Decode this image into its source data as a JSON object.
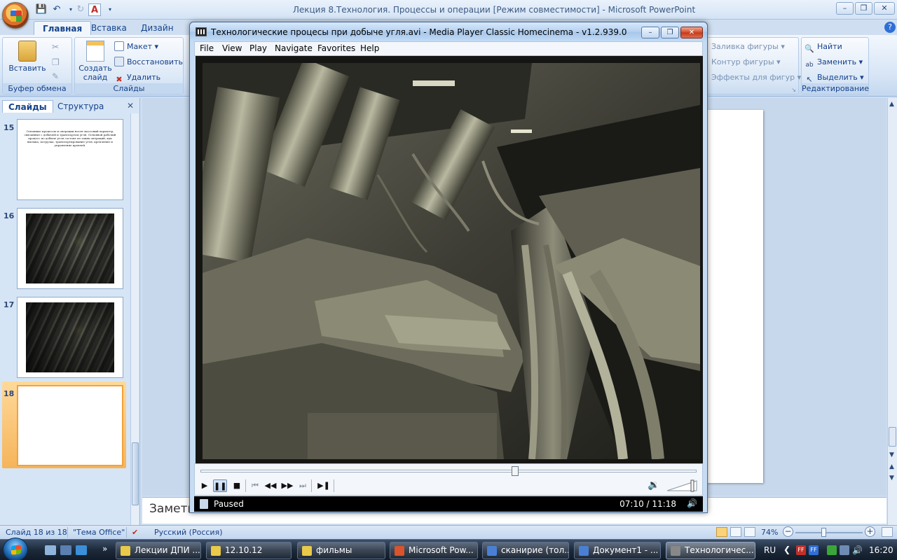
{
  "powerpoint": {
    "window_title": "Лекция 8.Технология. Процессы и операции [Режим совместимости] - Microsoft PowerPoint",
    "tabs": [
      "Главная",
      "Вставка",
      "Дизайн"
    ],
    "clipboard": {
      "paste_label": "Вставить",
      "group_label": "Буфер обмена"
    },
    "slides_group": {
      "new_slide_label": "Создать слайд",
      "layout_label": "Макет",
      "reset_label": "Восстановить",
      "delete_label": "Удалить",
      "group_label": "Слайды"
    },
    "drawing_group": {
      "fill_label": "Заливка фигуры",
      "outline_label": "Контур фигуры",
      "effects_label": "Эффекты для фигур"
    },
    "editing_group": {
      "find_label": "Найти",
      "replace_label": "Заменить",
      "select_label": "Выделить",
      "group_label": "Редактирование"
    },
    "pane_tabs": [
      "Слайды",
      "Структура"
    ],
    "slides": [
      {
        "number": "15",
        "text": "Основные процессы и операции носят массовый характер, связанные с добычей и транспортом угля. Основной рабочий процесс по добыче угля состоит из таких операций, как выемка, погрузка, транспортирование угля, крепление и управление кровлей."
      },
      {
        "number": "16"
      },
      {
        "number": "17"
      },
      {
        "number": "18"
      }
    ],
    "notes_label": "Заметк",
    "status": {
      "slide_info": "Слайд 18 из 18",
      "theme": "\"Тема Office\"",
      "language": "Русский (Россия)",
      "zoom": "74%",
      "zoom_level_fraction": 0.42
    }
  },
  "media_player": {
    "title": "Технологические процесы при добыче угля.avi - Media Player Classic Homecinema - v1.2.939.0",
    "menu": [
      "File",
      "View",
      "Play",
      "Navigate",
      "Favorites",
      "Help"
    ],
    "status_text": "Paused",
    "time": "07:10 / 11:18",
    "seek_fraction": 0.634,
    "volume_fraction": 0.9
  },
  "taskbar": {
    "items": [
      {
        "label": "Лекции ДПИ ...",
        "color": "#e8c94a"
      },
      {
        "label": "12.10.12",
        "color": "#e8c94a"
      },
      {
        "label": "фильмы",
        "color": "#e8c94a"
      },
      {
        "label": "Microsoft Pow...",
        "color": "#d9532c"
      },
      {
        "label": "сканирие (тол...",
        "color": "#4a7fd4"
      },
      {
        "label": "Документ1 - ...",
        "color": "#4a7fd4"
      },
      {
        "label": "Технологичес...",
        "color": "#888888"
      }
    ],
    "language": "RU",
    "clock": "16:20"
  }
}
